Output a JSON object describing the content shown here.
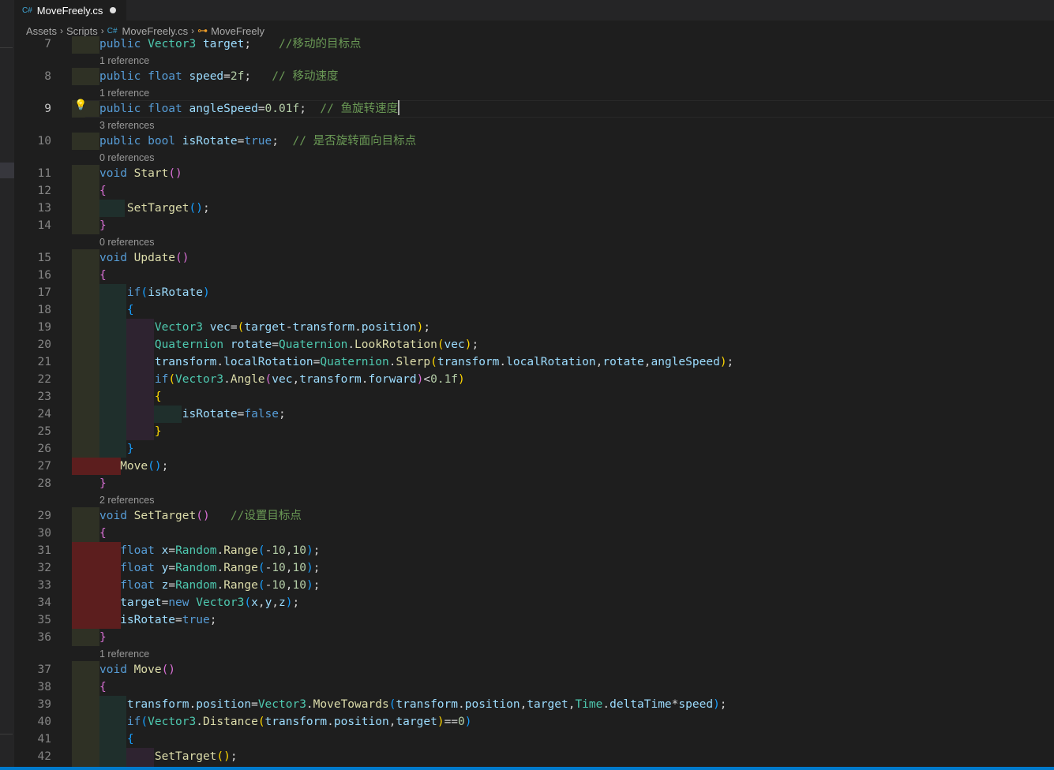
{
  "tab": {
    "icon_text": "C#",
    "filename": "MoveFreely.cs",
    "dirty": true
  },
  "breadcrumbs": {
    "items": [
      "Assets",
      "Scripts",
      "MoveFreely.cs",
      "MoveFreely"
    ],
    "file_icon_text": "C#",
    "class_icon": "class-icon"
  },
  "editor": {
    "active_line": 9,
    "colors": {
      "keyword": "#569cd6",
      "type": "#4ec9b0",
      "function": "#dcdcaa",
      "variable": "#9cdcfe",
      "number": "#b5cea8",
      "comment": "#6a9955"
    },
    "codelens": [
      "1 reference",
      "1 reference",
      "3 references",
      "0 references",
      "0 references",
      "2 references",
      "1 reference"
    ],
    "lines": [
      {
        "n": "7",
        "segments": [
          [
            "kw",
            "public "
          ],
          [
            "ty",
            "Vector3 "
          ],
          [
            "va",
            "target"
          ],
          [
            "op",
            ";    "
          ],
          [
            "cm",
            "//移动的目标点"
          ]
        ]
      },
      {
        "n": "8",
        "segments": [
          [
            "kw",
            "public "
          ],
          [
            "kw",
            "float "
          ],
          [
            "va",
            "speed"
          ],
          [
            "op",
            "="
          ],
          [
            "nu",
            "2f"
          ],
          [
            "op",
            ";   "
          ],
          [
            "cm",
            "// 移动速度"
          ]
        ]
      },
      {
        "n": "9",
        "segments": [
          [
            "kw",
            "public "
          ],
          [
            "kw",
            "float "
          ],
          [
            "va",
            "angleSpeed"
          ],
          [
            "op",
            "="
          ],
          [
            "nu",
            "0.01f"
          ],
          [
            "op",
            ";  "
          ],
          [
            "cm",
            "// 鱼旋转速度"
          ]
        ]
      },
      {
        "n": "10",
        "segments": [
          [
            "kw",
            "public "
          ],
          [
            "kw",
            "bool "
          ],
          [
            "va",
            "isRotate"
          ],
          [
            "op",
            "="
          ],
          [
            "kw",
            "true"
          ],
          [
            "op",
            ";  "
          ],
          [
            "cm",
            "// 是否旋转面向目标点"
          ]
        ]
      },
      {
        "n": "11",
        "segments": [
          [
            "kw",
            "void "
          ],
          [
            "fn",
            "Start"
          ],
          [
            "b2",
            "()"
          ]
        ]
      },
      {
        "n": "12",
        "segments": [
          [
            "b2",
            "{"
          ]
        ]
      },
      {
        "n": "13",
        "segments": [
          [
            "op",
            "    "
          ],
          [
            "fn",
            "SetTarget"
          ],
          [
            "b3",
            "()"
          ],
          [
            "op",
            ";"
          ]
        ]
      },
      {
        "n": "14",
        "segments": [
          [
            "b2",
            "}"
          ]
        ]
      },
      {
        "n": "15",
        "segments": [
          [
            "kw",
            "void "
          ],
          [
            "fn",
            "Update"
          ],
          [
            "b2",
            "()"
          ]
        ]
      },
      {
        "n": "16",
        "segments": [
          [
            "b2",
            "{"
          ]
        ]
      },
      {
        "n": "17",
        "segments": [
          [
            "op",
            "    "
          ],
          [
            "kw",
            "if"
          ],
          [
            "b3",
            "("
          ],
          [
            "va",
            "isRotate"
          ],
          [
            "b3",
            ")"
          ]
        ]
      },
      {
        "n": "18",
        "segments": [
          [
            "op",
            "    "
          ],
          [
            "b3",
            "{"
          ]
        ]
      },
      {
        "n": "19",
        "segments": [
          [
            "op",
            "        "
          ],
          [
            "ty",
            "Vector3 "
          ],
          [
            "va",
            "vec"
          ],
          [
            "op",
            "="
          ],
          [
            "b1",
            "("
          ],
          [
            "va",
            "target"
          ],
          [
            "op",
            "-"
          ],
          [
            "va",
            "transform"
          ],
          [
            "op",
            "."
          ],
          [
            "va",
            "position"
          ],
          [
            "b1",
            ")"
          ],
          [
            "op",
            ";"
          ]
        ]
      },
      {
        "n": "20",
        "segments": [
          [
            "op",
            "        "
          ],
          [
            "ty",
            "Quaternion "
          ],
          [
            "va",
            "rotate"
          ],
          [
            "op",
            "="
          ],
          [
            "ty",
            "Quaternion"
          ],
          [
            "op",
            "."
          ],
          [
            "fn",
            "LookRotation"
          ],
          [
            "b1",
            "("
          ],
          [
            "va",
            "vec"
          ],
          [
            "b1",
            ")"
          ],
          [
            "op",
            ";"
          ]
        ]
      },
      {
        "n": "21",
        "segments": [
          [
            "op",
            "        "
          ],
          [
            "va",
            "transform"
          ],
          [
            "op",
            "."
          ],
          [
            "va",
            "localRotation"
          ],
          [
            "op",
            "="
          ],
          [
            "ty",
            "Quaternion"
          ],
          [
            "op",
            "."
          ],
          [
            "fn",
            "Slerp"
          ],
          [
            "b1",
            "("
          ],
          [
            "va",
            "transform"
          ],
          [
            "op",
            "."
          ],
          [
            "va",
            "localRotation"
          ],
          [
            "op",
            ","
          ],
          [
            "va",
            "rotate"
          ],
          [
            "op",
            ","
          ],
          [
            "va",
            "angleSpeed"
          ],
          [
            "b1",
            ")"
          ],
          [
            "op",
            ";"
          ]
        ]
      },
      {
        "n": "22",
        "segments": [
          [
            "op",
            "        "
          ],
          [
            "kw",
            "if"
          ],
          [
            "b1",
            "("
          ],
          [
            "ty",
            "Vector3"
          ],
          [
            "op",
            "."
          ],
          [
            "fn",
            "Angle"
          ],
          [
            "b2",
            "("
          ],
          [
            "va",
            "vec"
          ],
          [
            "op",
            ","
          ],
          [
            "va",
            "transform"
          ],
          [
            "op",
            "."
          ],
          [
            "va",
            "forward"
          ],
          [
            "b2",
            ")"
          ],
          [
            "op",
            "<"
          ],
          [
            "nu",
            "0.1f"
          ],
          [
            "b1",
            ")"
          ]
        ]
      },
      {
        "n": "23",
        "segments": [
          [
            "op",
            "        "
          ],
          [
            "b1",
            "{"
          ]
        ]
      },
      {
        "n": "24",
        "segments": [
          [
            "op",
            "            "
          ],
          [
            "va",
            "isRotate"
          ],
          [
            "op",
            "="
          ],
          [
            "kw",
            "false"
          ],
          [
            "op",
            ";"
          ]
        ]
      },
      {
        "n": "25",
        "segments": [
          [
            "op",
            "        "
          ],
          [
            "b1",
            "}"
          ]
        ]
      },
      {
        "n": "26",
        "segments": [
          [
            "op",
            "    "
          ],
          [
            "b3",
            "}"
          ]
        ]
      },
      {
        "n": "27",
        "segments": [
          [
            "op",
            "   "
          ],
          [
            "fn",
            "Move"
          ],
          [
            "b3",
            "()"
          ],
          [
            "op",
            ";"
          ]
        ]
      },
      {
        "n": "28",
        "segments": [
          [
            "b2",
            "}"
          ]
        ]
      },
      {
        "n": "29",
        "segments": [
          [
            "kw",
            "void "
          ],
          [
            "fn",
            "SetTarget"
          ],
          [
            "b2",
            "()"
          ],
          [
            "op",
            "   "
          ],
          [
            "cm",
            "//设置目标点"
          ]
        ]
      },
      {
        "n": "30",
        "segments": [
          [
            "b2",
            "{"
          ]
        ]
      },
      {
        "n": "31",
        "segments": [
          [
            "op",
            "   "
          ],
          [
            "kw",
            "float "
          ],
          [
            "va",
            "x"
          ],
          [
            "op",
            "="
          ],
          [
            "ty",
            "Random"
          ],
          [
            "op",
            "."
          ],
          [
            "fn",
            "Range"
          ],
          [
            "b3",
            "("
          ],
          [
            "op",
            "-"
          ],
          [
            "nu",
            "10"
          ],
          [
            "op",
            ","
          ],
          [
            "nu",
            "10"
          ],
          [
            "b3",
            ")"
          ],
          [
            "op",
            ";"
          ]
        ]
      },
      {
        "n": "32",
        "segments": [
          [
            "op",
            "   "
          ],
          [
            "kw",
            "float "
          ],
          [
            "va",
            "y"
          ],
          [
            "op",
            "="
          ],
          [
            "ty",
            "Random"
          ],
          [
            "op",
            "."
          ],
          [
            "fn",
            "Range"
          ],
          [
            "b3",
            "("
          ],
          [
            "op",
            "-"
          ],
          [
            "nu",
            "10"
          ],
          [
            "op",
            ","
          ],
          [
            "nu",
            "10"
          ],
          [
            "b3",
            ")"
          ],
          [
            "op",
            ";"
          ]
        ]
      },
      {
        "n": "33",
        "segments": [
          [
            "op",
            "   "
          ],
          [
            "kw",
            "float "
          ],
          [
            "va",
            "z"
          ],
          [
            "op",
            "="
          ],
          [
            "ty",
            "Random"
          ],
          [
            "op",
            "."
          ],
          [
            "fn",
            "Range"
          ],
          [
            "b3",
            "("
          ],
          [
            "op",
            "-"
          ],
          [
            "nu",
            "10"
          ],
          [
            "op",
            ","
          ],
          [
            "nu",
            "10"
          ],
          [
            "b3",
            ")"
          ],
          [
            "op",
            ";"
          ]
        ]
      },
      {
        "n": "34",
        "segments": [
          [
            "op",
            "   "
          ],
          [
            "va",
            "target"
          ],
          [
            "op",
            "="
          ],
          [
            "kw",
            "new "
          ],
          [
            "ty",
            "Vector3"
          ],
          [
            "b3",
            "("
          ],
          [
            "va",
            "x"
          ],
          [
            "op",
            ","
          ],
          [
            "va",
            "y"
          ],
          [
            "op",
            ","
          ],
          [
            "va",
            "z"
          ],
          [
            "b3",
            ")"
          ],
          [
            "op",
            ";"
          ]
        ]
      },
      {
        "n": "35",
        "segments": [
          [
            "op",
            "   "
          ],
          [
            "va",
            "isRotate"
          ],
          [
            "op",
            "="
          ],
          [
            "kw",
            "true"
          ],
          [
            "op",
            ";"
          ]
        ]
      },
      {
        "n": "36",
        "segments": [
          [
            "b2",
            "}"
          ]
        ]
      },
      {
        "n": "37",
        "segments": [
          [
            "kw",
            "void "
          ],
          [
            "fn",
            "Move"
          ],
          [
            "b2",
            "()"
          ]
        ]
      },
      {
        "n": "38",
        "segments": [
          [
            "b2",
            "{"
          ]
        ]
      },
      {
        "n": "39",
        "segments": [
          [
            "op",
            "    "
          ],
          [
            "va",
            "transform"
          ],
          [
            "op",
            "."
          ],
          [
            "va",
            "position"
          ],
          [
            "op",
            "="
          ],
          [
            "ty",
            "Vector3"
          ],
          [
            "op",
            "."
          ],
          [
            "fn",
            "MoveTowards"
          ],
          [
            "b3",
            "("
          ],
          [
            "va",
            "transform"
          ],
          [
            "op",
            "."
          ],
          [
            "va",
            "position"
          ],
          [
            "op",
            ","
          ],
          [
            "va",
            "target"
          ],
          [
            "op",
            ","
          ],
          [
            "ty",
            "Time"
          ],
          [
            "op",
            "."
          ],
          [
            "va",
            "deltaTime"
          ],
          [
            "op",
            "*"
          ],
          [
            "va",
            "speed"
          ],
          [
            "b3",
            ")"
          ],
          [
            "op",
            ";"
          ]
        ]
      },
      {
        "n": "40",
        "segments": [
          [
            "op",
            "    "
          ],
          [
            "kw",
            "if"
          ],
          [
            "b3",
            "("
          ],
          [
            "ty",
            "Vector3"
          ],
          [
            "op",
            "."
          ],
          [
            "fn",
            "Distance"
          ],
          [
            "b1",
            "("
          ],
          [
            "va",
            "transform"
          ],
          [
            "op",
            "."
          ],
          [
            "va",
            "position"
          ],
          [
            "op",
            ","
          ],
          [
            "va",
            "target"
          ],
          [
            "b1",
            ")"
          ],
          [
            "op",
            "=="
          ],
          [
            "nu",
            "0"
          ],
          [
            "b3",
            ")"
          ]
        ]
      },
      {
        "n": "41",
        "segments": [
          [
            "op",
            "    "
          ],
          [
            "b3",
            "{"
          ]
        ]
      },
      {
        "n": "42",
        "segments": [
          [
            "op",
            "        "
          ],
          [
            "fn",
            "SetTarget"
          ],
          [
            "b1",
            "()"
          ],
          [
            "op",
            ";"
          ]
        ]
      }
    ]
  }
}
